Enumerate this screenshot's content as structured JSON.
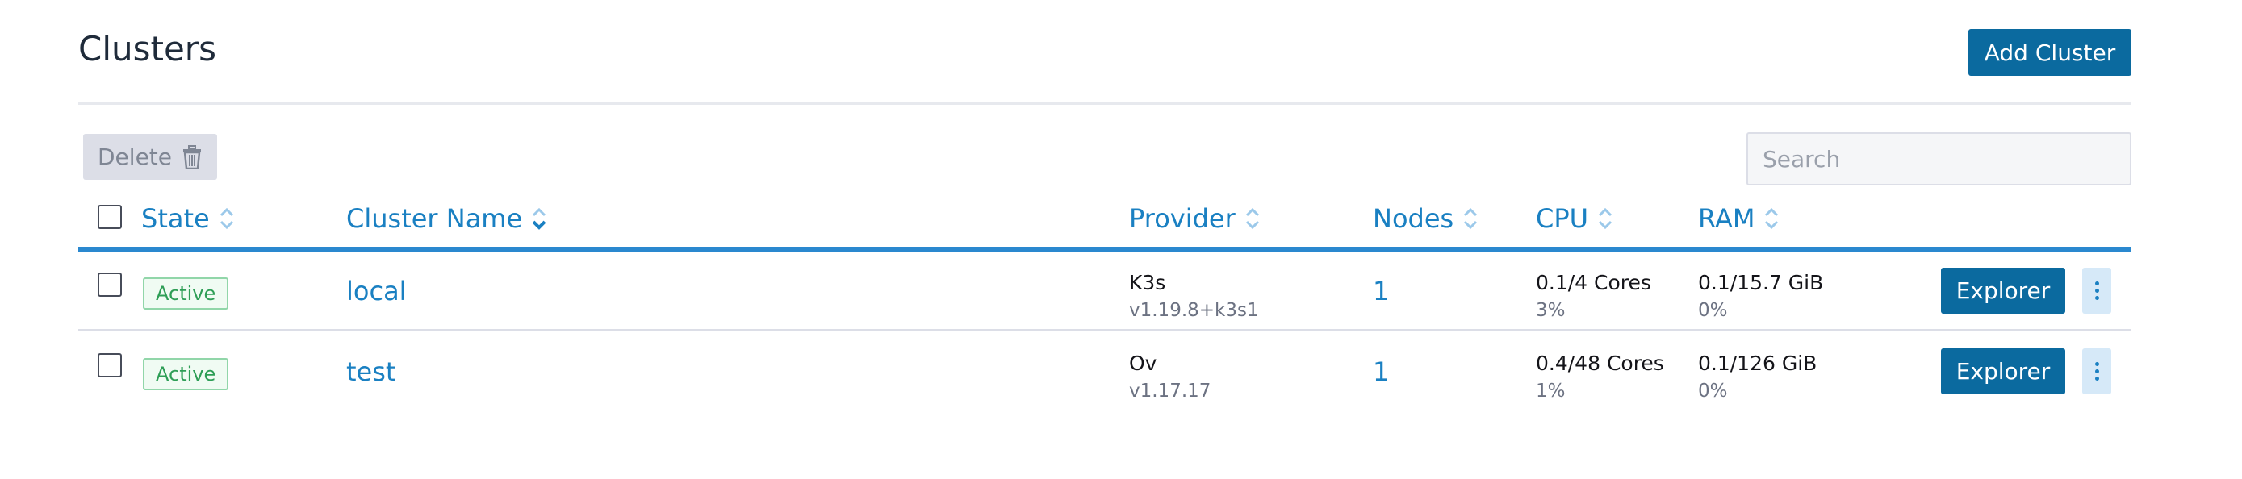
{
  "header": {
    "title": "Clusters",
    "add_button": "Add Cluster"
  },
  "toolbar": {
    "delete_label": "Delete",
    "search_placeholder": "Search"
  },
  "table": {
    "columns": [
      "State",
      "Cluster Name",
      "Provider",
      "Nodes",
      "CPU",
      "RAM"
    ],
    "rows": [
      {
        "state": "Active",
        "name": "local",
        "provider": "K3s",
        "provider_version": "v1.19.8+k3s1",
        "nodes": "1",
        "cpu": "0.1/4 Cores",
        "cpu_pct": "3%",
        "ram": "0.1/15.7 GiB",
        "ram_pct": "0%",
        "action": "Explorer"
      },
      {
        "state": "Active",
        "name": "test",
        "provider": "Ov",
        "provider_version": "v1.17.17",
        "nodes": "1",
        "cpu": "0.4/48 Cores",
        "cpu_pct": "1%",
        "ram": "0.1/126 GiB",
        "ram_pct": "0%",
        "action": "Explorer"
      }
    ]
  },
  "icons": {
    "delete": "trash-icon",
    "sort": "sort-icon",
    "row_menu": "kebab-menu-icon"
  },
  "colors": {
    "primary": "#0b6a9f",
    "link": "#1a80c2",
    "active_text": "#2e9e56",
    "active_border": "#91d6a9"
  }
}
